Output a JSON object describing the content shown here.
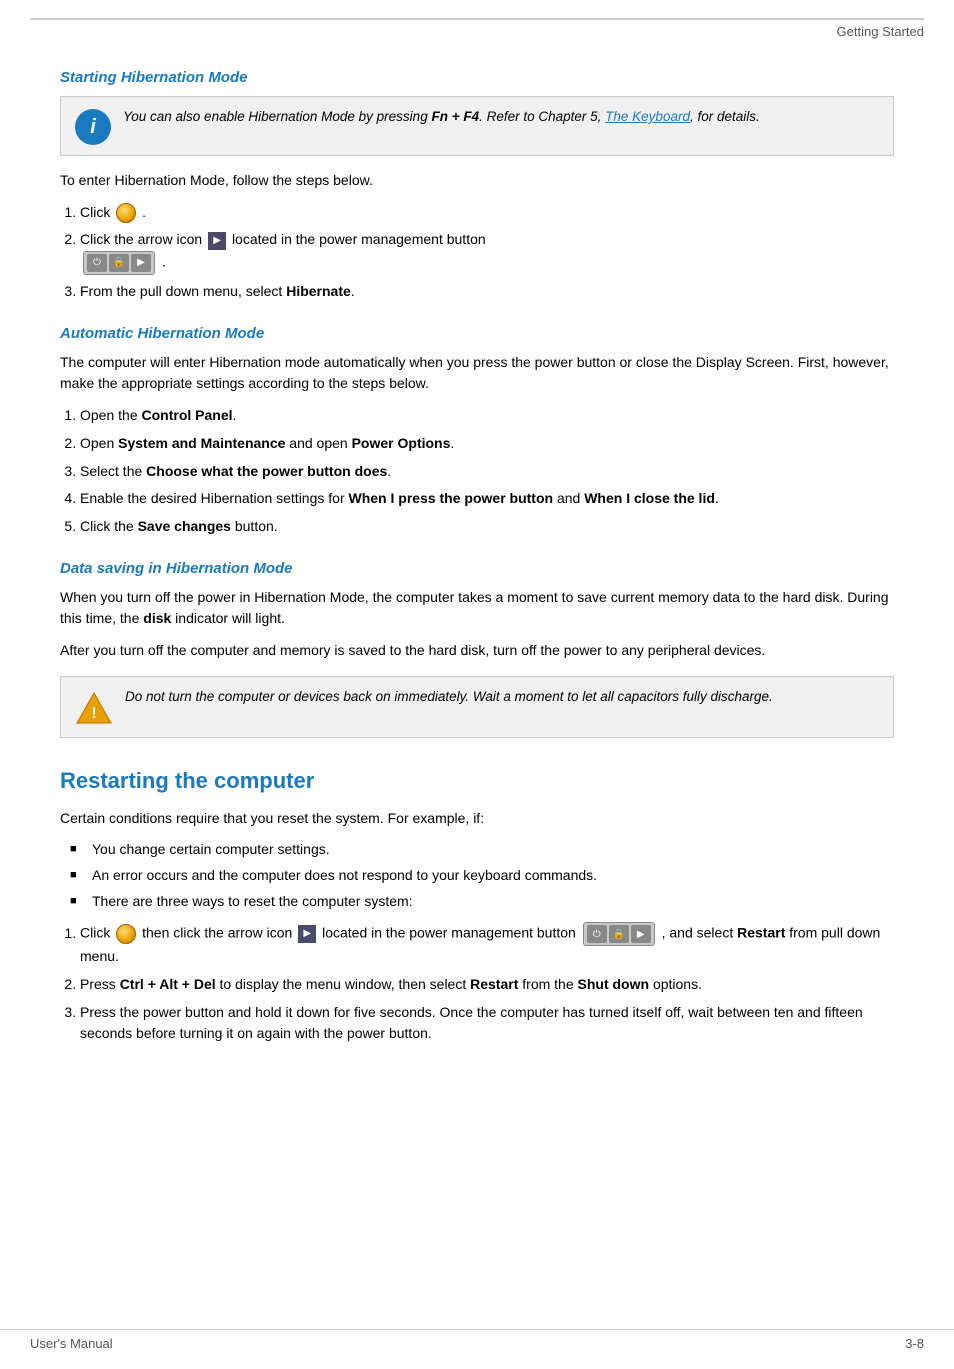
{
  "header": {
    "chapter": "Getting Started"
  },
  "footer": {
    "left": "User's Manual",
    "right": "3-8"
  },
  "sections": {
    "starting_hibernation": {
      "title": "Starting Hibernation Mode",
      "info_note": "You can also enable Hibernation Mode by pressing ",
      "info_bold": "Fn + F4",
      "info_note2": ". Refer to Chapter 5, ",
      "info_link": "The Keyboard",
      "info_note3": ", for details.",
      "intro": "To enter Hibernation Mode, follow the steps below.",
      "steps": [
        {
          "id": 1,
          "text_before": "Click ",
          "text_after": "."
        },
        {
          "id": 2,
          "text_before": "Click the arrow icon ",
          "text_after": " located in the power management button ",
          "text_end": "."
        },
        {
          "id": 3,
          "text_before": "From the pull down menu, select ",
          "bold": "Hibernate",
          "text_after": "."
        }
      ]
    },
    "automatic_hibernation": {
      "title": "Automatic Hibernation Mode",
      "intro": "The computer will enter Hibernation mode automatically when you press the power button or close the Display Screen. First, however, make the appropriate settings according to the steps below.",
      "steps": [
        {
          "id": 1,
          "text": "Open the ",
          "bold": "Control Panel",
          "after": "."
        },
        {
          "id": 2,
          "text": "Open ",
          "bold1": "System and Maintenance",
          "mid": " and open ",
          "bold2": "Power Options",
          "after": "."
        },
        {
          "id": 3,
          "text": "Select the ",
          "bold": "Choose what the power button does",
          "after": "."
        },
        {
          "id": 4,
          "text": "Enable the desired Hibernation settings for ",
          "bold1": "When I press the power button",
          "mid": " and ",
          "bold2": "When I close the lid",
          "after": "."
        },
        {
          "id": 5,
          "text": "Click the ",
          "bold": "Save changes",
          "after": " button."
        }
      ]
    },
    "data_saving": {
      "title": "Data saving in Hibernation Mode",
      "para1": "When you turn off the power in Hibernation Mode, the computer takes a moment to save current memory data to the hard disk. During this time, the ",
      "para1_bold": "disk",
      "para1_end": " indicator will light.",
      "para2": "After you turn off the computer and memory is saved to the hard disk, turn off the power to any peripheral devices.",
      "warning": "Do not turn the computer or devices back on immediately. Wait a moment to let all capacitors fully discharge."
    },
    "restarting": {
      "title": "Restarting the computer",
      "intro": "Certain conditions require that you reset the system. For example, if:",
      "bullets": [
        "You change certain computer settings.",
        "An error occurs and the computer does not respond to your keyboard commands.",
        "There are three ways to reset the computer system:"
      ],
      "steps": [
        {
          "id": 1,
          "text": "Click ",
          "mid": " then click the arrow icon ",
          "mid2": " located in the power management button ",
          "end": ", and select ",
          "bold": "Restart",
          "final": " from pull down menu."
        },
        {
          "id": 2,
          "text": "Press ",
          "bold1": "Ctrl + Alt + Del",
          "mid": " to display the menu window, then select ",
          "bold2": "Restart",
          "end": " from the ",
          "bold3": "Shut down",
          "final": " options."
        },
        {
          "id": 3,
          "text": "Press the power button and hold it down for five seconds. Once the computer has turned itself off, wait between ten and fifteen seconds before turning it on again with the power button."
        }
      ]
    }
  }
}
